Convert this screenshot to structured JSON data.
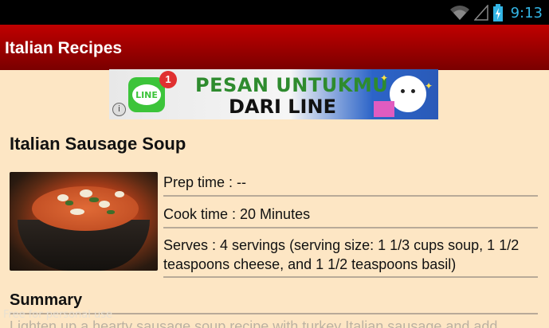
{
  "statusbar": {
    "time": "9:13",
    "icons": [
      "wifi-icon",
      "signal-icon",
      "battery-charging-icon"
    ]
  },
  "actionbar": {
    "title": "Italian Recipes"
  },
  "ad": {
    "badge_count": "1",
    "logo_text": "LINE",
    "headline": "PESAN UNTUKMU",
    "subline": "DARI LINE",
    "info_icon": "i"
  },
  "recipe": {
    "title": "Italian Sausage Soup",
    "prep_time": "Prep time : --",
    "cook_time": "Cook time : 20 Minutes",
    "serves": "Serves : 4 servings (serving size: 1 1/3 cups soup, 1 1/2 teaspoons cheese, and 1 1/2 teaspoons basil)"
  },
  "summary": {
    "heading": "Summary",
    "text": "Lighten up a hearty sausage soup recipe with turkey Italian sausage and add"
  },
  "watermark": "Free for personal use",
  "colors": {
    "accent": "#c00000",
    "background": "#fde6c4",
    "status_time": "#33b5e5"
  }
}
